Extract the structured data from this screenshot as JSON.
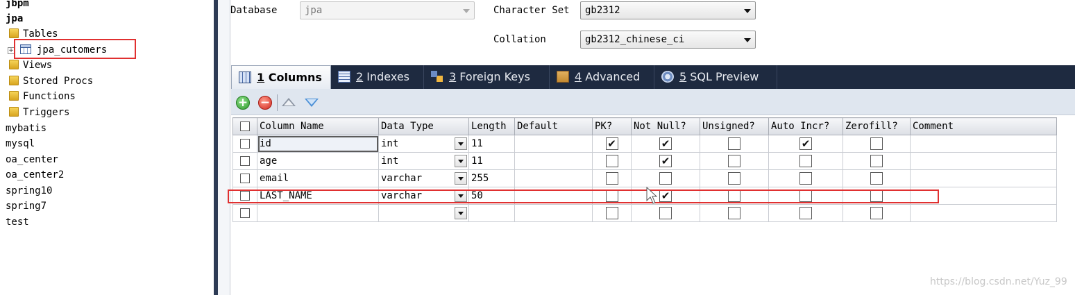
{
  "tree": {
    "items": [
      {
        "label": "jbpm",
        "indent": 0,
        "bold": true,
        "icon": "none"
      },
      {
        "label": "jpa",
        "indent": 0,
        "bold": true,
        "icon": "none"
      },
      {
        "label": "Tables",
        "indent": 1,
        "bold": false,
        "icon": "folder-icon"
      },
      {
        "label": "jpa_cutomers",
        "indent": 2,
        "bold": false,
        "icon": "table-icon"
      },
      {
        "label": "Views",
        "indent": 1,
        "bold": false,
        "icon": "folder-icon"
      },
      {
        "label": "Stored Procs",
        "indent": 1,
        "bold": false,
        "icon": "folder-icon"
      },
      {
        "label": "Functions",
        "indent": 1,
        "bold": false,
        "icon": "folder-icon"
      },
      {
        "label": "Triggers",
        "indent": 1,
        "bold": false,
        "icon": "folder-icon"
      },
      {
        "label": "mybatis",
        "indent": 0,
        "bold": false,
        "icon": "none"
      },
      {
        "label": "mysql",
        "indent": 0,
        "bold": false,
        "icon": "none"
      },
      {
        "label": "oa_center",
        "indent": 0,
        "bold": false,
        "icon": "none"
      },
      {
        "label": "oa_center2",
        "indent": 0,
        "bold": false,
        "icon": "none"
      },
      {
        "label": "spring10",
        "indent": 0,
        "bold": false,
        "icon": "none"
      },
      {
        "label": "spring7",
        "indent": 0,
        "bold": false,
        "icon": "none"
      },
      {
        "label": "test",
        "indent": 0,
        "bold": false,
        "icon": "none"
      }
    ],
    "expander_symbol": "+"
  },
  "form": {
    "database_label": "Database",
    "database_value": "jpa",
    "charset_label": "Character Set",
    "charset_value": "gb2312",
    "collation_label": "Collation",
    "collation_value": "gb2312_chinese_ci"
  },
  "tabs": [
    {
      "num": "1",
      "label": " Columns",
      "icon": "columns-icon",
      "active": true
    },
    {
      "num": "2",
      "label": " Indexes",
      "icon": "indexes-icon",
      "active": false
    },
    {
      "num": "3",
      "label": " Foreign Keys",
      "icon": "foreign-keys-icon",
      "active": false
    },
    {
      "num": "4",
      "label": " Advanced",
      "icon": "advanced-icon",
      "active": false
    },
    {
      "num": "5",
      "label": " SQL Preview",
      "icon": "sql-preview-icon",
      "active": false
    }
  ],
  "toolbar": {
    "add_symbol": "+",
    "remove_symbol": "−"
  },
  "grid": {
    "headers": [
      "Column Name",
      "Data Type",
      "Length",
      "Default",
      "PK?",
      "Not Null?",
      "Unsigned?",
      "Auto Incr?",
      "Zerofill?",
      "Comment"
    ],
    "rows": [
      {
        "name": "id",
        "type": "int",
        "length": "11",
        "default": "",
        "pk": true,
        "notnull": true,
        "unsigned": false,
        "autoincr": true,
        "zerofill": false,
        "comment": ""
      },
      {
        "name": "age",
        "type": "int",
        "length": "11",
        "default": "",
        "pk": false,
        "notnull": true,
        "unsigned": false,
        "autoincr": false,
        "zerofill": false,
        "comment": ""
      },
      {
        "name": "email",
        "type": "varchar",
        "length": "255",
        "default": "",
        "pk": false,
        "notnull": false,
        "unsigned": false,
        "autoincr": false,
        "zerofill": false,
        "comment": ""
      },
      {
        "name": "LAST_NAME",
        "type": "varchar",
        "length": "50",
        "default": "",
        "pk": false,
        "notnull": true,
        "unsigned": false,
        "autoincr": false,
        "zerofill": false,
        "comment": ""
      },
      {
        "name": "",
        "type": "",
        "length": "",
        "default": "",
        "pk": false,
        "notnull": false,
        "unsigned": false,
        "autoincr": false,
        "zerofill": false,
        "comment": ""
      }
    ],
    "check_mark": "✔"
  },
  "watermark": "https://blog.csdn.net/Yuz_99",
  "colors": {
    "tabbar_bg": "#1e2a40",
    "highlight_red": "#e03030",
    "toolbar_bg": "#dfe6ef"
  }
}
